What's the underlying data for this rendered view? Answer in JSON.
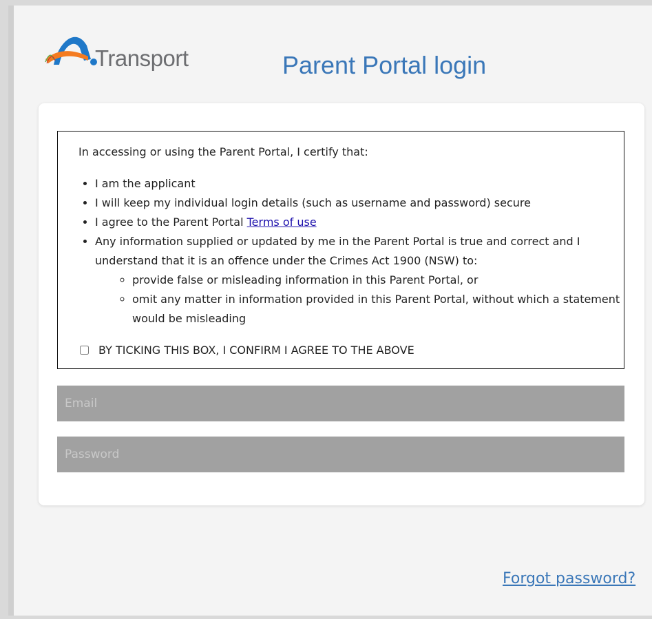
{
  "header": {
    "logo_text": "Transport",
    "title": "Parent Portal login"
  },
  "terms": {
    "intro": "In accessing or using the Parent Portal, I certify that:",
    "items": [
      "I am the applicant",
      "I will keep my individual login details (such as username and password) secure",
      "I agree to the Parent Portal ",
      "Any information supplied or updated by me in the Parent Portal is true and correct and I understand that it is an offence under the Crimes Act 1900 (NSW) to:"
    ],
    "terms_link": "Terms of use",
    "sub_items": [
      "provide false or misleading information in this Parent Portal, or",
      "omit any matter in information provided in this Parent Portal, without which a statement would be misleading"
    ],
    "agree_label": "BY TICKING THIS BOX, I CONFIRM I AGREE TO THE ABOVE",
    "agree_checked": false
  },
  "form": {
    "email_placeholder": "Email",
    "email_value": "",
    "password_placeholder": "Password",
    "password_value": ""
  },
  "links": {
    "forgot_password": "Forgot password?"
  },
  "colors": {
    "accent": "#3a77b8",
    "field_bg": "#a1a1a1",
    "logo_blue": "#1f78c8",
    "logo_orange": "#f47b20"
  },
  "icons": {
    "logo": "transport-logo-icon"
  }
}
